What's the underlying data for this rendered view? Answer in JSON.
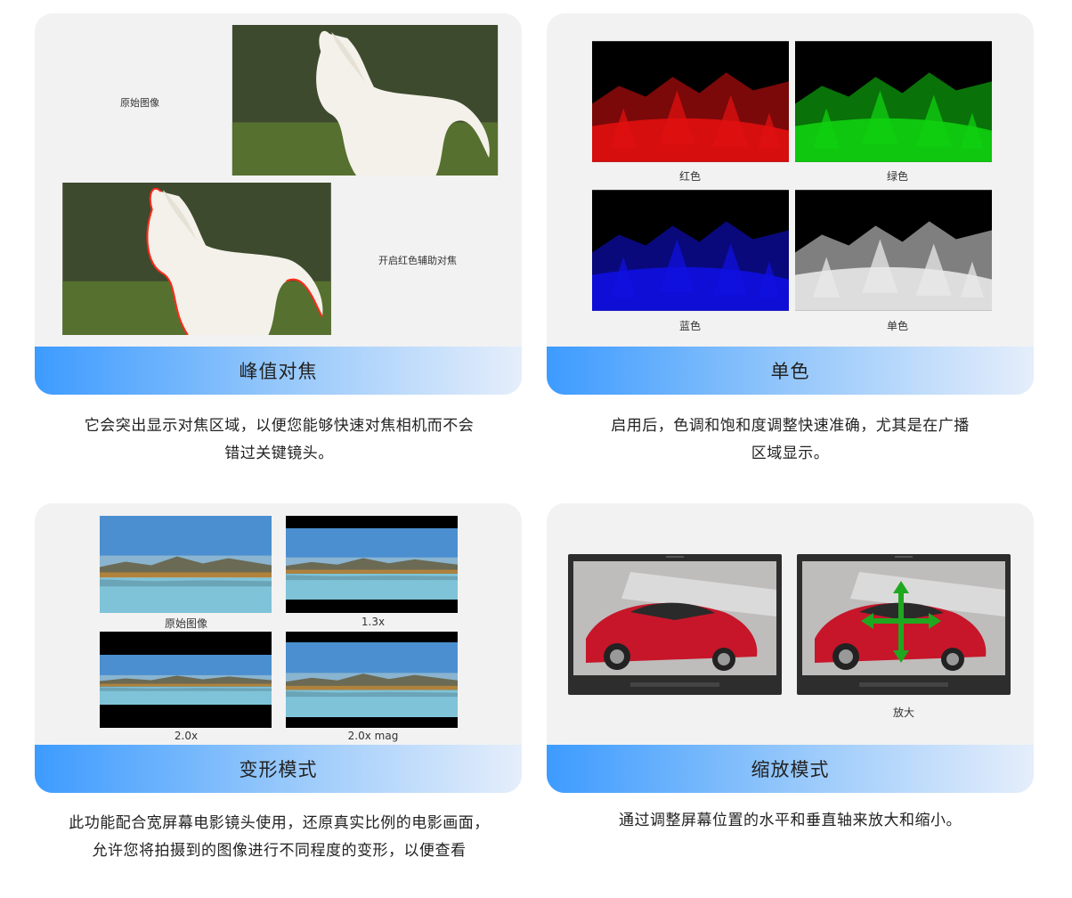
{
  "sections": [
    {
      "title": "峰值对焦",
      "description": [
        "它会突出显示对焦区域，以便您能够快速对焦相机而不会",
        "错过关键镜头。"
      ],
      "captions": [
        "原始图像",
        "开启红色辅助对焦"
      ]
    },
    {
      "title": "单色",
      "description": [
        "启用后，色调和饱和度调整快速准确，尤其是在广播",
        "区域显示。"
      ],
      "captions": [
        "红色",
        "绿色",
        "蓝色",
        "单色"
      ]
    },
    {
      "title": "变形模式",
      "description": [
        "此功能配合宽屏幕电影镜头使用，还原真实比例的电影画面，",
        "允许您将拍摄到的图像进行不同程度的变形，以便查看"
      ],
      "captions": [
        "原始图像",
        "1.3x",
        "2.0x",
        "2.0x mag"
      ]
    },
    {
      "title": "缩放模式",
      "description": [
        "通过调整屏幕位置的水平和垂直轴来放大和缩小。"
      ],
      "captions": [
        "放大"
      ]
    }
  ],
  "colors": {
    "card_bg": "#f2f2f2",
    "bar_start": "#3d9bff",
    "bar_end": "#e5eefb",
    "channel_red": "#e01010",
    "channel_green": "#10d010",
    "channel_blue": "#1010e0",
    "arrow_green": "#1fa81f"
  }
}
